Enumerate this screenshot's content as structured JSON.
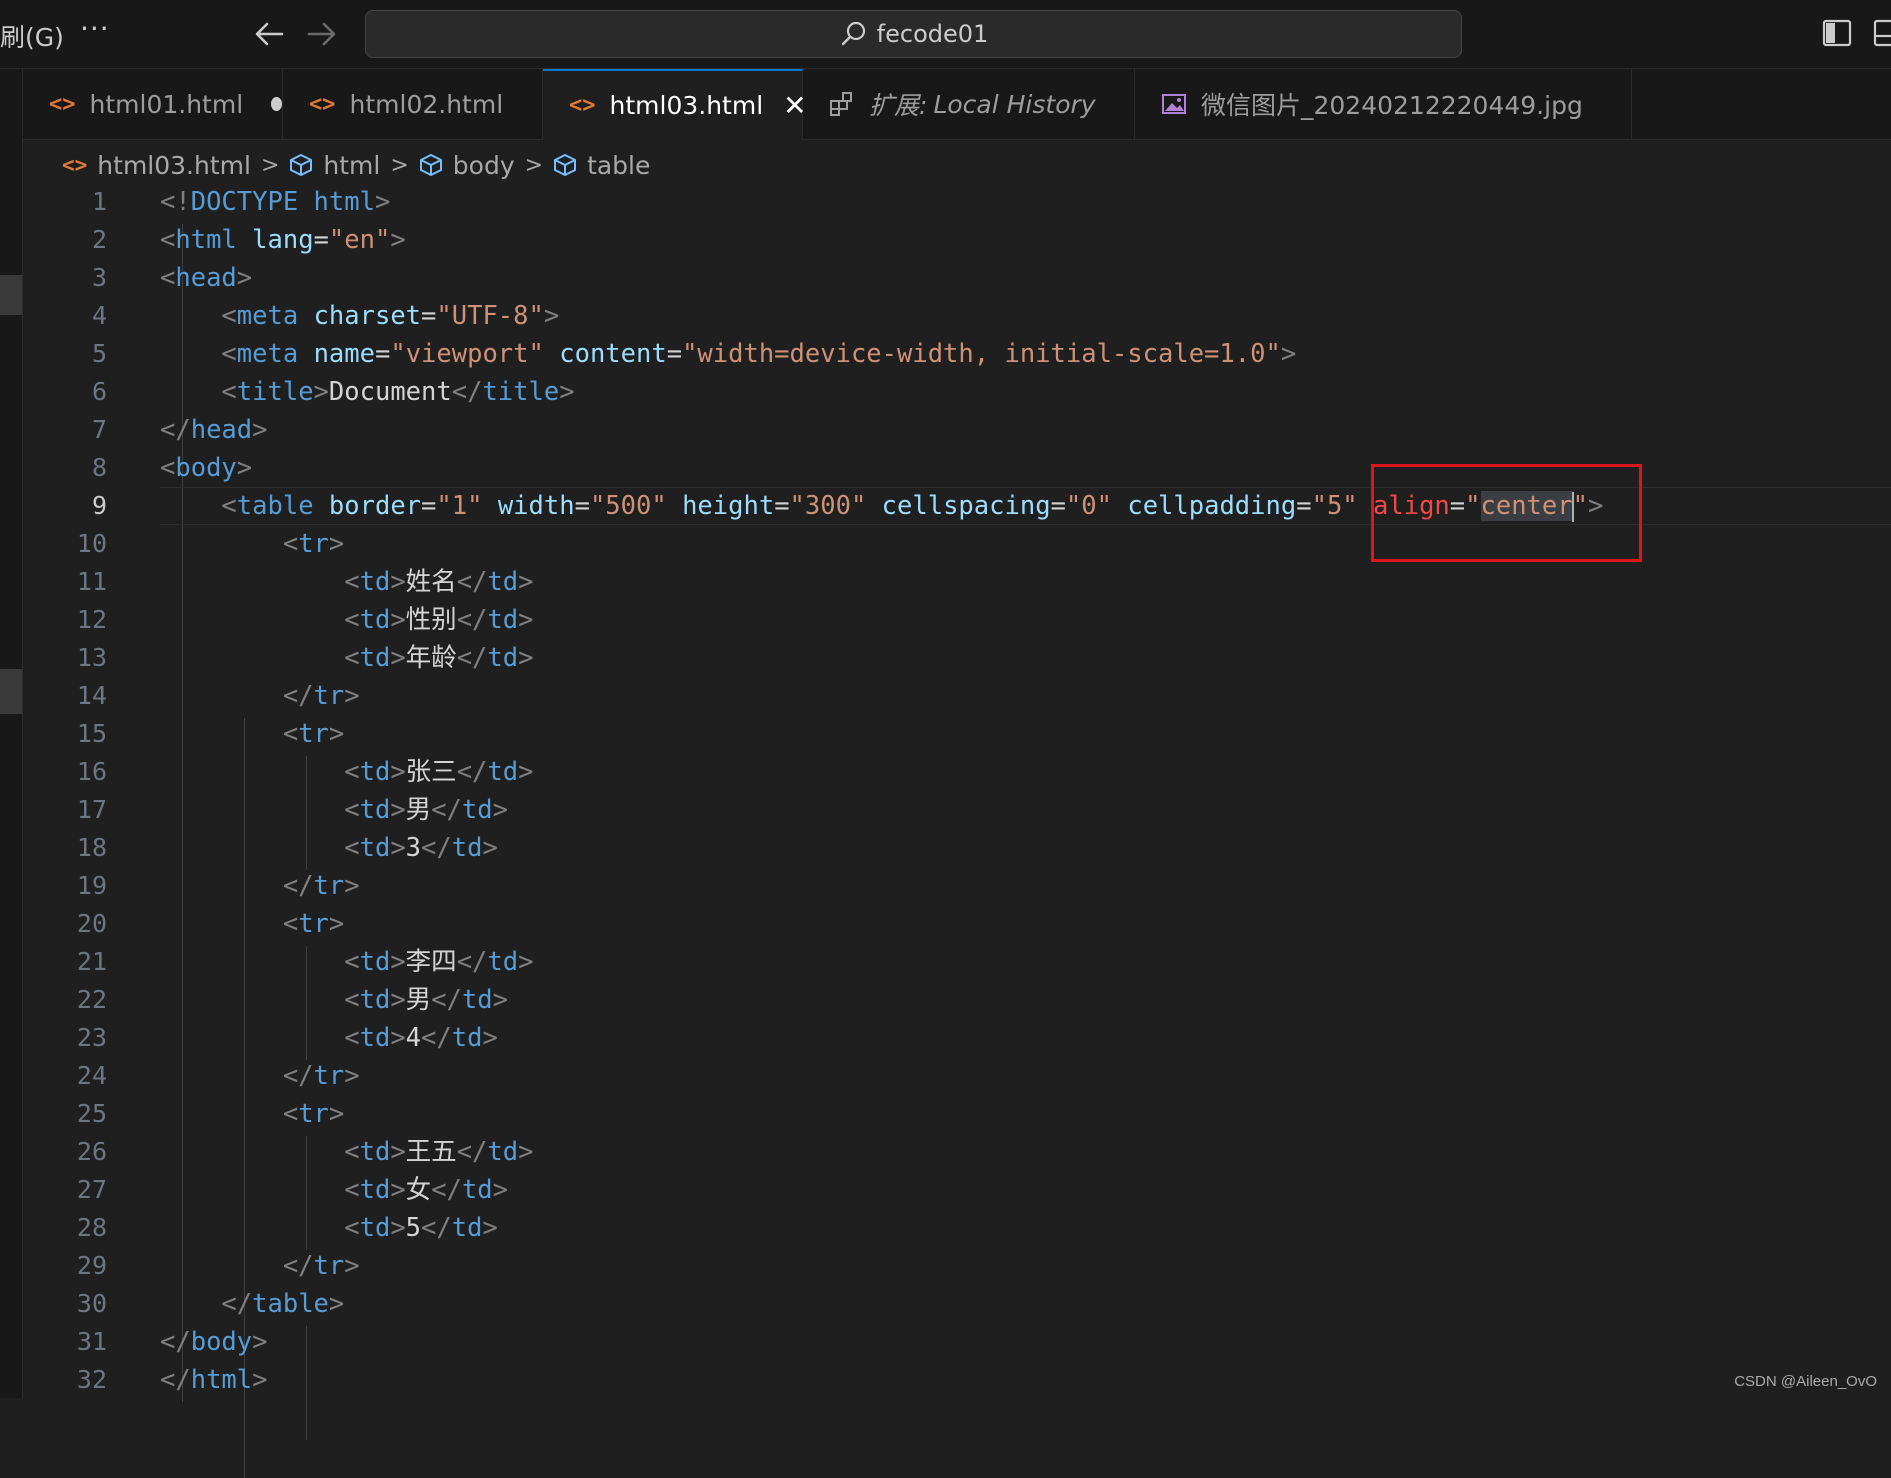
{
  "titlebar": {
    "menu_item": "刷(G)",
    "more": "···",
    "search_text": "fecode01"
  },
  "tabs": [
    {
      "label": "html01.html",
      "icon": "html-code-icon",
      "dirty": true
    },
    {
      "label": "html02.html",
      "icon": "html-code-icon"
    },
    {
      "label": "html03.html",
      "icon": "html-code-icon",
      "active": true
    },
    {
      "prefix": "扩展:",
      "label": "Local History",
      "icon": "extension-icon"
    },
    {
      "label": "微信图片_20240212220449.jpg",
      "icon": "image-icon"
    }
  ],
  "breadcrumb": [
    "html03.html",
    "html",
    "body",
    "table"
  ],
  "editor": {
    "current_line": 9,
    "line_numbers": [
      "1",
      "2",
      "3",
      "4",
      "5",
      "6",
      "7",
      "8",
      "9",
      "10",
      "11",
      "12",
      "13",
      "14",
      "15",
      "16",
      "17",
      "18",
      "19",
      "20",
      "21",
      "22",
      "23",
      "24",
      "25",
      "26",
      "27",
      "28",
      "29",
      "30",
      "31",
      "32"
    ],
    "lines": [
      "<!DOCTYPE html>",
      "<html lang=\"en\">",
      "<head>",
      "    <meta charset=\"UTF-8\">",
      "    <meta name=\"viewport\" content=\"width=device-width, initial-scale=1.0\">",
      "    <title>Document</title>",
      "</head>",
      "<body>",
      "    <table border=\"1\" width=\"500\" height=\"300\" cellspacing=\"0\" cellpadding=\"5\" align=\"center\">",
      "        <tr>",
      "            <td>姓名</td>",
      "            <td>性别</td>",
      "            <td>年龄</td>",
      "        </tr>",
      "        <tr>",
      "            <td>张三</td>",
      "            <td>男</td>",
      "            <td>3</td>",
      "        </tr>",
      "        <tr>",
      "            <td>李四</td>",
      "            <td>男</td>",
      "            <td>4</td>",
      "        </tr>",
      "        <tr>",
      "            <td>王五</td>",
      "            <td>女</td>",
      "            <td>5</td>",
      "        </tr>",
      "    </table>",
      "</body>",
      "</html>"
    ]
  },
  "watermark": "CSDN @Aileen_OvO",
  "colors": {
    "tag": "#569cd6",
    "attr": "#9cdcfe",
    "string": "#ce9178",
    "punctuation": "#808080",
    "error_attr": "#f44747",
    "annotation_box": "#e0141e",
    "tab_accent": "#0078d4",
    "html_icon": "#e37933"
  }
}
